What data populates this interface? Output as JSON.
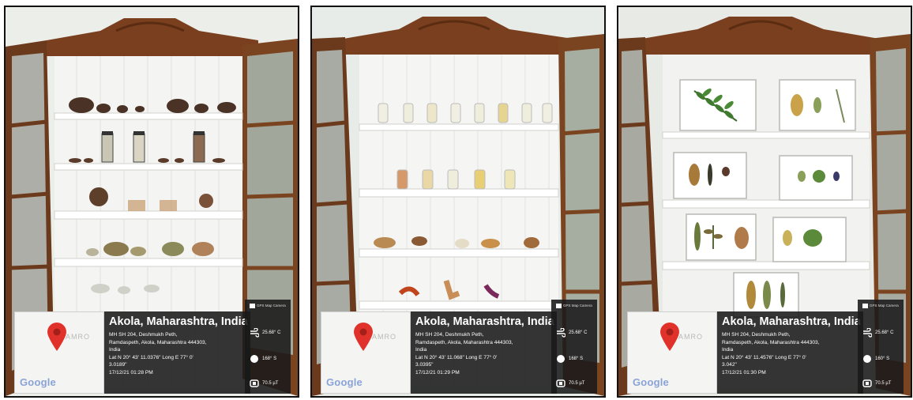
{
  "panels": [
    {
      "place": "Akola, Maharashtra, India",
      "address_line1": "MH SH 204, Deshmukh Peth,",
      "address_line2": "Ramdaspeth, Akola, Maharashtra 444303,",
      "address_line3": "India",
      "latlong": "Lat N 20° 43' 11.0376\" Long E 77° 0'",
      "latlong_cont": "3.0189\"",
      "datetime": "17/12/21 01:28 PM",
      "temperature": "25.68° C",
      "humidity": "168° S",
      "magnetic": "70.5 µT",
      "camera_tag": "GPS Map Camera",
      "map_ghost": "AMRO",
      "google": "Google",
      "colors": {
        "pin": "#e0322b",
        "overlay": "#1a1a1a",
        "wood": "#7a3f1e",
        "shelf": "#f2f2f0"
      },
      "icons": [
        "map-pin-icon",
        "wind-icon",
        "humidity-icon",
        "magnet-icon"
      ]
    },
    {
      "place": "Akola, Maharashtra, India",
      "address_line1": "MH SH 204, Deshmukh Peth,",
      "address_line2": "Ramdaspeth, Akola, Maharashtra 444303,",
      "address_line3": "India",
      "latlong": "Lat N 20° 43' 11.068\" Long E 77° 0'",
      "latlong_cont": "3.0395\"",
      "datetime": "17/12/21 01:29 PM",
      "temperature": "25.68° C",
      "humidity": "168° S",
      "magnetic": "70.5 µT",
      "camera_tag": "GPS Map Camera",
      "map_ghost": "AMRO",
      "google": "Google"
    },
    {
      "place": "Akola, Maharashtra, India",
      "address_line1": "MH SH 204, Deshmukh Peth,",
      "address_line2": "Ramdaspeth, Akola, Maharashtra 444303,",
      "address_line3": "India",
      "latlong": "Lat N 20° 43' 11.4576\" Long E 77° 0'",
      "latlong_cont": "3.042\"",
      "datetime": "17/12/21 01:30 PM",
      "temperature": "25.68° C",
      "humidity": "160° S",
      "magnetic": "70.5 µT",
      "camera_tag": "GPS Map Camera",
      "map_ghost": "AMRO",
      "google": "Google"
    }
  ]
}
